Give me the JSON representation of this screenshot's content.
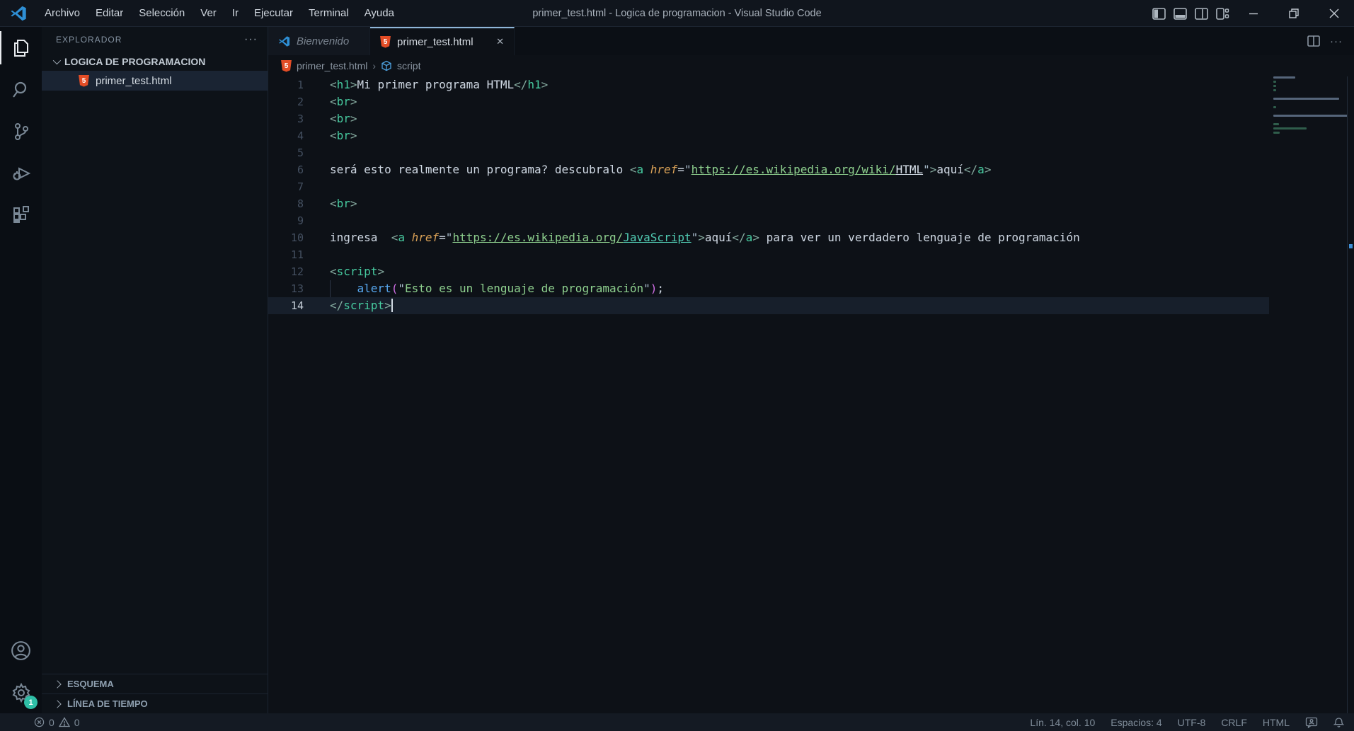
{
  "window": {
    "title": "primer_test.html - Logica de programacion - Visual Studio Code",
    "menus": [
      "Archivo",
      "Editar",
      "Selección",
      "Ver",
      "Ir",
      "Ejecutar",
      "Terminal",
      "Ayuda"
    ]
  },
  "icons": {
    "more_actions": "···",
    "tab_close": "✕",
    "breadcrumb_sep": "›",
    "html5_text": "5"
  },
  "activity_bar": {
    "items": [
      "explorer",
      "search",
      "source-control",
      "run-and-debug",
      "extensions"
    ],
    "active_item": "explorer",
    "settings_badge": "1"
  },
  "sidebar": {
    "header": "EXPLORADOR",
    "folder": "LOGICA DE PROGRAMACION",
    "file": "primer_test.html",
    "sections": {
      "outline": "ESQUEMA",
      "timeline": "LÍNEA DE TIEMPO"
    }
  },
  "tabs": [
    {
      "label": "Bienvenido",
      "active": false
    },
    {
      "label": "primer_test.html",
      "active": true
    }
  ],
  "breadcrumb": {
    "file": "primer_test.html",
    "symbol": "script"
  },
  "editor": {
    "cursor": {
      "line": 14,
      "col": 10
    },
    "lines": [
      {
        "n": 1,
        "tokens": [
          {
            "t": "<",
            "c": "pun"
          },
          {
            "t": "h1",
            "c": "tag"
          },
          {
            "t": ">",
            "c": "pun"
          },
          {
            "t": "Mi primer programa HTML",
            "c": "pln"
          },
          {
            "t": "</",
            "c": "pun"
          },
          {
            "t": "h1",
            "c": "tag"
          },
          {
            "t": ">",
            "c": "pun"
          }
        ]
      },
      {
        "n": 2,
        "tokens": [
          {
            "t": "<",
            "c": "pun"
          },
          {
            "t": "br",
            "c": "tag"
          },
          {
            "t": ">",
            "c": "pun"
          }
        ]
      },
      {
        "n": 3,
        "tokens": [
          {
            "t": "<",
            "c": "pun"
          },
          {
            "t": "br",
            "c": "tag"
          },
          {
            "t": ">",
            "c": "pun"
          }
        ]
      },
      {
        "n": 4,
        "tokens": [
          {
            "t": "<",
            "c": "pun"
          },
          {
            "t": "br",
            "c": "tag"
          },
          {
            "t": ">",
            "c": "pun"
          }
        ]
      },
      {
        "n": 5,
        "tokens": []
      },
      {
        "n": 6,
        "tokens": [
          {
            "t": "será esto realmente un programa? descubralo ",
            "c": "pln"
          },
          {
            "t": "<",
            "c": "pun"
          },
          {
            "t": "a",
            "c": "tag"
          },
          {
            "t": " ",
            "c": "pln"
          },
          {
            "t": "href",
            "c": "attr"
          },
          {
            "t": "=",
            "c": "pln"
          },
          {
            "t": "\"",
            "c": "q"
          },
          {
            "t": "https://es.wikipedia.org/wiki/",
            "c": "str u"
          },
          {
            "t": "HTML",
            "c": "strw u"
          },
          {
            "t": "\"",
            "c": "q"
          },
          {
            "t": ">",
            "c": "pun"
          },
          {
            "t": "aquí",
            "c": "pln"
          },
          {
            "t": "</",
            "c": "pun"
          },
          {
            "t": "a",
            "c": "tag"
          },
          {
            "t": ">",
            "c": "pun"
          }
        ]
      },
      {
        "n": 7,
        "tokens": []
      },
      {
        "n": 8,
        "tokens": [
          {
            "t": "<",
            "c": "pun"
          },
          {
            "t": "br",
            "c": "tag"
          },
          {
            "t": ">",
            "c": "pun"
          }
        ]
      },
      {
        "n": 9,
        "tokens": []
      },
      {
        "n": 10,
        "tokens": [
          {
            "t": "ingresa  ",
            "c": "pln"
          },
          {
            "t": "<",
            "c": "pun"
          },
          {
            "t": "a",
            "c": "tag"
          },
          {
            "t": " ",
            "c": "pln"
          },
          {
            "t": "href",
            "c": "attr"
          },
          {
            "t": "=",
            "c": "pln"
          },
          {
            "t": "\"",
            "c": "q"
          },
          {
            "t": "https://es.wikipedia.org/",
            "c": "str u"
          },
          {
            "t": "JavaScript",
            "c": "strt u"
          },
          {
            "t": "\"",
            "c": "q"
          },
          {
            "t": ">",
            "c": "pun"
          },
          {
            "t": "aquí",
            "c": "pln"
          },
          {
            "t": "</",
            "c": "pun"
          },
          {
            "t": "a",
            "c": "tag"
          },
          {
            "t": ">",
            "c": "pun"
          },
          {
            "t": " para ver un verdadero lenguaje de programación",
            "c": "pln"
          }
        ]
      },
      {
        "n": 11,
        "tokens": []
      },
      {
        "n": 12,
        "tokens": [
          {
            "t": "<",
            "c": "pun"
          },
          {
            "t": "script",
            "c": "tag"
          },
          {
            "t": ">",
            "c": "pun"
          }
        ]
      },
      {
        "n": 13,
        "indent_guide": true,
        "tokens": [
          {
            "t": "    ",
            "c": "pln"
          },
          {
            "t": "alert",
            "c": "fn"
          },
          {
            "t": "(",
            "c": "brk"
          },
          {
            "t": "\"",
            "c": "q"
          },
          {
            "t": "Esto es un lenguaje de programación",
            "c": "str"
          },
          {
            "t": "\"",
            "c": "q"
          },
          {
            "t": ")",
            "c": "brk"
          },
          {
            "t": ";",
            "c": "pln"
          }
        ]
      },
      {
        "n": 14,
        "current": true,
        "tokens": [
          {
            "t": "</",
            "c": "pun"
          },
          {
            "t": "script",
            "c": "tag"
          },
          {
            "t": ">",
            "c": "pun"
          }
        ]
      }
    ]
  },
  "status_bar": {
    "errors": "0",
    "warnings": "0",
    "position": "Lín. 14, col. 10",
    "indentation": "Espacios: 4",
    "encoding": "UTF-8",
    "eol": "CRLF",
    "language": "HTML"
  },
  "colors": {
    "html5_orange": "#e44d26",
    "badge_teal": "#2fbfa7",
    "active_tab_border": "#8fb6d9",
    "vscode_blue": "#2e8fd5",
    "syntax": {
      "tag": "#47cba0",
      "punctuation": "#84a99e",
      "attribute": "#dba257",
      "string": "#8ed08e",
      "function": "#57a8f0",
      "bracket": "#cf6ee4",
      "text": "#cfd8e3"
    }
  }
}
